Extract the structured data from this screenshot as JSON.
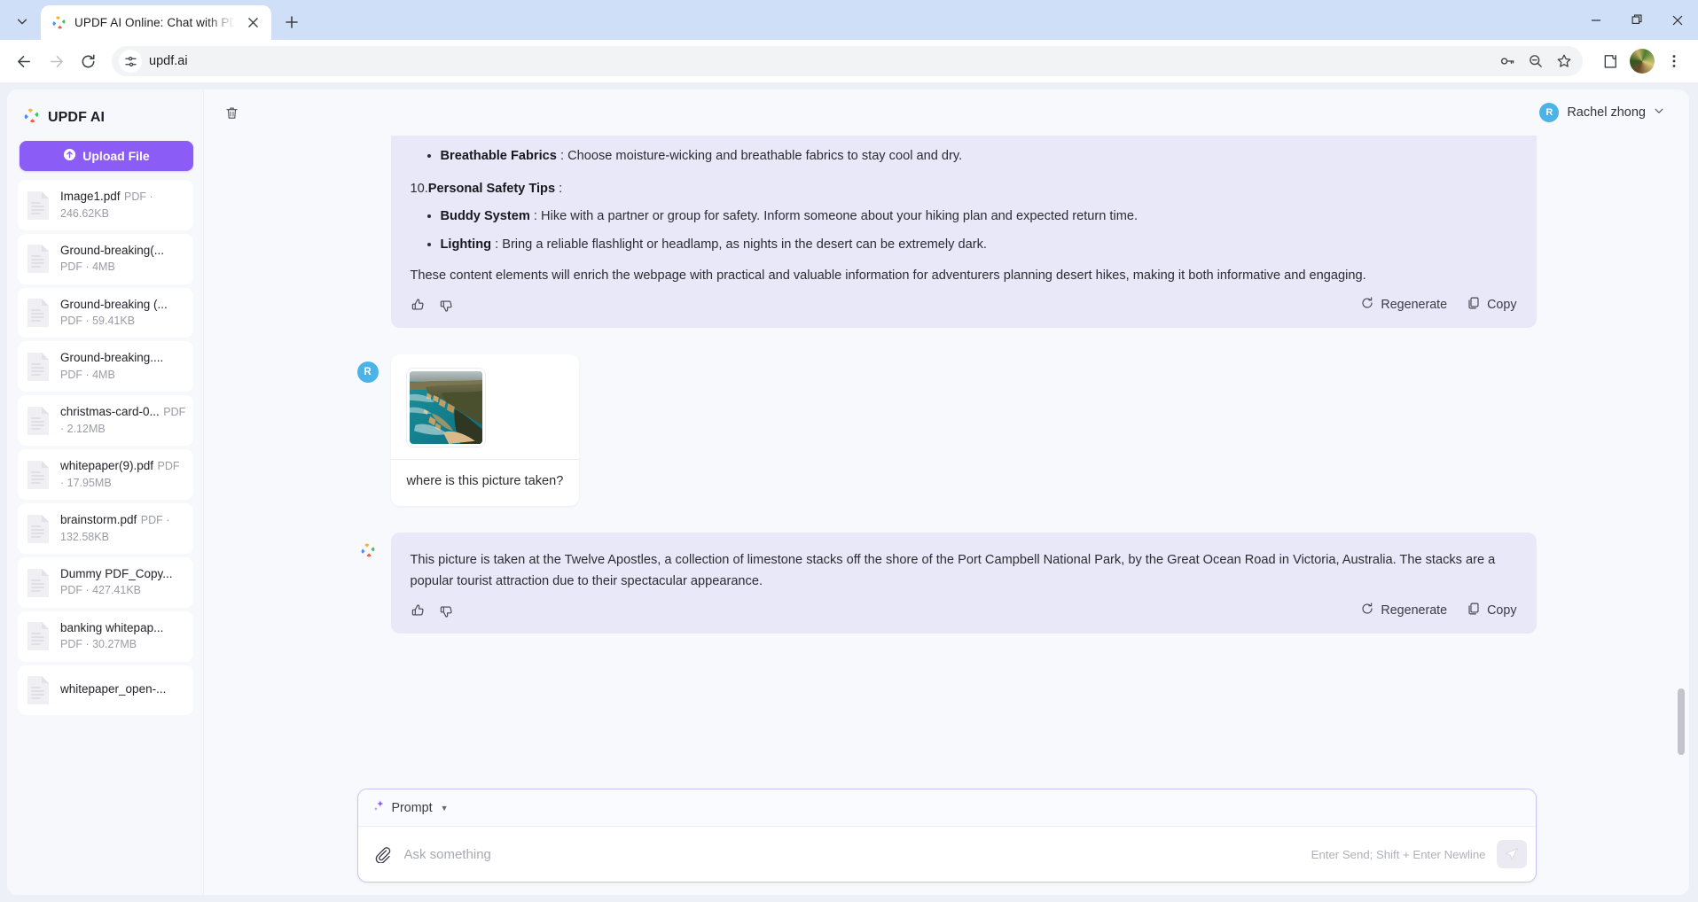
{
  "browser": {
    "tab": {
      "title": "UPDF AI Online: Chat with PDF a",
      "favicon": "updf-logo-icon",
      "close": "close-icon"
    },
    "new_tab_label": "+",
    "window_controls": {
      "minimize": "minimize-icon",
      "maximize": "maximize-icon",
      "close": "close-icon"
    },
    "url": "updf.ai",
    "nav": {
      "back": "back-arrow-icon",
      "forward": "forward-arrow-icon",
      "reload": "reload-icon"
    },
    "omnibox_icons": [
      "passwords-key-icon",
      "zoom-out-icon",
      "bookmark-star-icon"
    ],
    "toolbar_icons": [
      "extensions-puzzle-icon",
      "profile-avatar",
      "chrome-menu-icon"
    ]
  },
  "sidebar": {
    "brand": "UPDF AI",
    "upload_label": "Upload File",
    "files": [
      {
        "name": "Image1.pdf",
        "meta": "PDF · 246.62KB"
      },
      {
        "name": "Ground-breaking(...",
        "meta": "PDF · 4MB"
      },
      {
        "name": "Ground-breaking (...",
        "meta": "PDF · 59.41KB"
      },
      {
        "name": "Ground-breaking....",
        "meta": "PDF · 4MB"
      },
      {
        "name": "christmas-card-0...",
        "meta": "PDF · 2.12MB"
      },
      {
        "name": "whitepaper(9).pdf",
        "meta": "PDF · 17.95MB"
      },
      {
        "name": "brainstorm.pdf",
        "meta": "PDF · 132.58KB"
      },
      {
        "name": "Dummy PDF_Copy...",
        "meta": "PDF · 427.41KB"
      },
      {
        "name": "banking whitepap...",
        "meta": "PDF · 30.27MB"
      },
      {
        "name": "whitepaper_open-...",
        "meta": ""
      }
    ]
  },
  "header": {
    "delete_icon": "trash-icon",
    "user_initial": "R",
    "user_name": "Rachel zhong",
    "chevron": "chevron-down-icon"
  },
  "chat": {
    "message1": {
      "bullet1_term": "Breathable Fabrics",
      "bullet1_text": " : Choose moisture-wicking and breathable fabrics to stay cool and dry.",
      "heading_num": "10.",
      "heading_term": "Personal Safety Tips",
      "heading_tail": " :",
      "bullet2_term": "Buddy System",
      "bullet2_text": " : Hike with a partner or group for safety. Inform someone about your hiking plan and expected return time.",
      "bullet3_term": "Lighting",
      "bullet3_text": " : Bring a reliable flashlight or headlamp, as nights in the desert can be extremely dark.",
      "closing": "These content elements will enrich the webpage with practical and valuable information for adventurers planning desert hikes, making it both informative and engaging.",
      "actions": {
        "like": "thumbs-up-icon",
        "dislike": "thumbs-down-icon",
        "regenerate": "Regenerate",
        "copy": "Copy"
      }
    },
    "message2": {
      "avatar_initial": "R",
      "attachment": "coastal-cliffs-photo",
      "text": "where is this picture taken?"
    },
    "message3": {
      "text": "This picture is taken at the Twelve Apostles, a collection of limestone stacks off the shore of the Port Campbell National Park, by the Great Ocean Road in Victoria, Australia. The stacks are a popular tourist attraction due to their spectacular appearance.",
      "actions": {
        "like": "thumbs-up-icon",
        "dislike": "thumbs-down-icon",
        "regenerate": "Regenerate",
        "copy": "Copy"
      }
    }
  },
  "composer": {
    "prompt_label": "Prompt",
    "prompt_icon": "sparkle-icon",
    "attach_icon": "paperclip-icon",
    "placeholder": "Ask something",
    "hint": "Enter Send; Shift + Enter Newline",
    "send_icon": "send-icon"
  },
  "colors": {
    "accent": "#8b5cf6",
    "ai_bubble": "#e9e8f8",
    "user_avatar": "#4cb3e8",
    "app_bg": "#eef0f8",
    "browser_chrome": "#cfdff7"
  }
}
